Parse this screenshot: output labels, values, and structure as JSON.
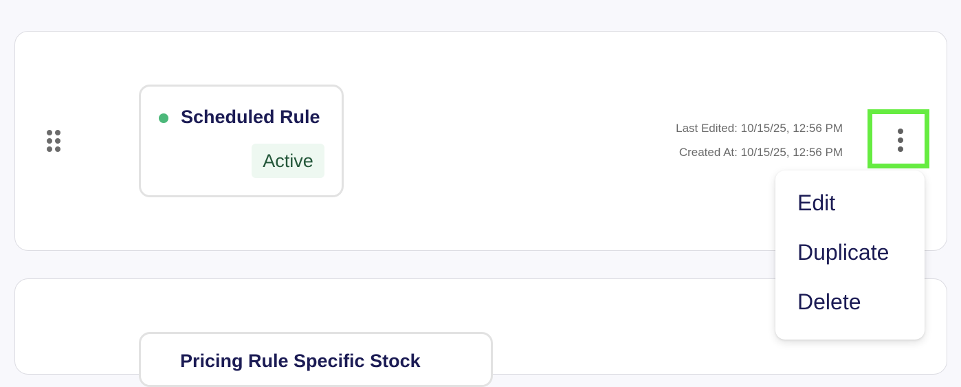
{
  "rules": [
    {
      "name": "Scheduled Rule",
      "status": "Active",
      "last_edited": "Last Edited: 10/15/25, 12:56 PM",
      "created_at": "Created At: 10/15/25, 12:56 PM"
    },
    {
      "name": "Pricing Rule Specific Stock"
    }
  ],
  "menu": {
    "items": [
      "Edit",
      "Duplicate",
      "Delete"
    ]
  },
  "icons": {
    "drag": "drag-handle-icon",
    "more": "more-vertical-icon",
    "status": "status-dot-icon"
  },
  "colors": {
    "status_active": "#4cb87a",
    "badge_bg": "#eef8f1",
    "badge_text": "#24573a",
    "title_text": "#1b1b54",
    "highlight": "#66ec41"
  }
}
